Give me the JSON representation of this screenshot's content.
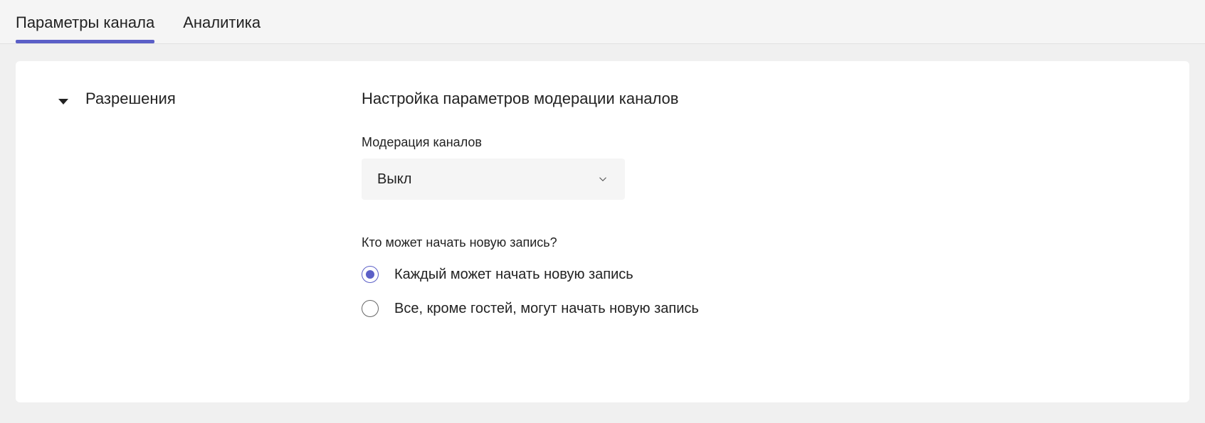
{
  "tabs": {
    "settings": "Параметры канала",
    "analytics": "Аналитика"
  },
  "section": {
    "label": "Разрешения"
  },
  "content": {
    "heading": "Настройка параметров модерации каналов",
    "moderation_label": "Модерация каналов",
    "moderation_value": "Выкл",
    "question": "Кто может начать новую запись?",
    "options": {
      "everyone": "Каждый может начать новую запись",
      "except_guests": "Все, кроме гостей, могут начать новую запись"
    }
  }
}
